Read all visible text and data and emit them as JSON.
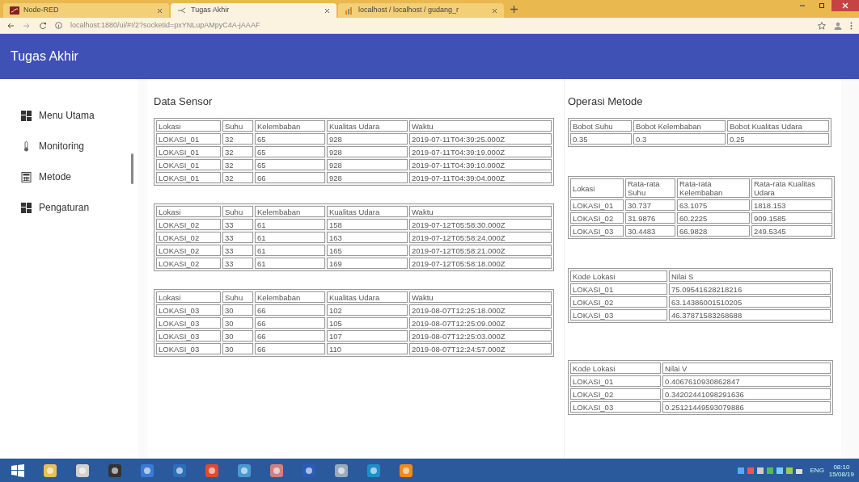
{
  "browser": {
    "tabs": [
      {
        "label": "Node-RED",
        "selected": false
      },
      {
        "label": "Tugas Akhir",
        "selected": true
      },
      {
        "label": "localhost / localhost / gudang_r",
        "selected": false
      }
    ],
    "address": "localhost:1880/ui/#!/2?socketid=pxYNLupAMpyC4A-jAAAF"
  },
  "app": {
    "title": "Tugas Akhir"
  },
  "sidebar": {
    "items": [
      {
        "label": "Menu Utama",
        "kind": "dashboard"
      },
      {
        "label": "Monitoring",
        "kind": "thermometer"
      },
      {
        "label": "Metode",
        "kind": "calculator"
      },
      {
        "label": "Pengaturan",
        "kind": "dashboard"
      }
    ]
  },
  "data_sensor": {
    "title": "Data Sensor",
    "tables": [
      {
        "columns": [
          "Lokasi",
          "Suhu",
          "Kelembaban",
          "Kualitas Udara",
          "Waktu"
        ],
        "rows": [
          [
            "LOKASI_01",
            "32",
            "65",
            "928",
            "2019-07-11T04:39:25.000Z"
          ],
          [
            "LOKASI_01",
            "32",
            "65",
            "928",
            "2019-07-11T04:39:19.000Z"
          ],
          [
            "LOKASI_01",
            "32",
            "65",
            "928",
            "2019-07-11T04:39:10.000Z"
          ],
          [
            "LOKASI_01",
            "32",
            "66",
            "928",
            "2019-07-11T04:39:04.000Z"
          ]
        ]
      },
      {
        "columns": [
          "Lokasi",
          "Suhu",
          "Kelembaban",
          "Kualitas Udara",
          "Waktu"
        ],
        "rows": [
          [
            "LOKASI_02",
            "33",
            "61",
            "158",
            "2019-07-12T05:58:30.000Z"
          ],
          [
            "LOKASI_02",
            "33",
            "61",
            "163",
            "2019-07-12T05:58:24.000Z"
          ],
          [
            "LOKASI_02",
            "33",
            "61",
            "165",
            "2019-07-12T05:58:21.000Z"
          ],
          [
            "LOKASI_02",
            "33",
            "61",
            "169",
            "2019-07-12T05:58:18.000Z"
          ]
        ]
      },
      {
        "columns": [
          "Lokasi",
          "Suhu",
          "Kelembaban",
          "Kualitas Udara",
          "Waktu"
        ],
        "rows": [
          [
            "LOKASI_03",
            "30",
            "66",
            "102",
            "2019-08-07T12:25:18.000Z"
          ],
          [
            "LOKASI_03",
            "30",
            "66",
            "105",
            "2019-08-07T12:25:09.000Z"
          ],
          [
            "LOKASI_03",
            "30",
            "66",
            "107",
            "2019-08-07T12:25:03.000Z"
          ],
          [
            "LOKASI_03",
            "30",
            "66",
            "110",
            "2019-08-07T12:24:57.000Z"
          ]
        ]
      }
    ]
  },
  "operasi_metode": {
    "title": "Operasi Metode",
    "tables": [
      {
        "columns": [
          "Bobot Suhu",
          "Bobot Kelembaban",
          "Bobot Kualitas Udara"
        ],
        "rows": [
          [
            "0.35",
            "0.3",
            "0.25"
          ]
        ]
      },
      {
        "columns": [
          "Lokasi",
          "Rata-rata Suhu",
          "Rata-rata Kelembaban",
          "Rata-rata Kualitas Udara"
        ],
        "rows": [
          [
            "LOKASI_01",
            "30.737",
            "63.1075",
            "1818.153"
          ],
          [
            "LOKASI_02",
            "31.9876",
            "60.2225",
            "909.1585"
          ],
          [
            "LOKASI_03",
            "30.4483",
            "66.9828",
            "249.5345"
          ]
        ]
      },
      {
        "columns": [
          "Kode Lokasi",
          "Nilai S"
        ],
        "rows": [
          [
            "LOKASI_01",
            "75.09541628218216"
          ],
          [
            "LOKASI_02",
            "63.14386001510205"
          ],
          [
            "LOKASI_03",
            "46.37871583268688"
          ]
        ]
      },
      {
        "columns": [
          "Kode Lokasi",
          "Nilai V"
        ],
        "rows": [
          [
            "LOKASI_01",
            "0.4067610930862847"
          ],
          [
            "LOKASI_02",
            "0.34202441098291636"
          ],
          [
            "LOKASI_03",
            "0.25121449593079886"
          ]
        ]
      }
    ]
  },
  "taskbar": {
    "language": "ENG",
    "time": "08:10",
    "date": "15/08/19"
  }
}
